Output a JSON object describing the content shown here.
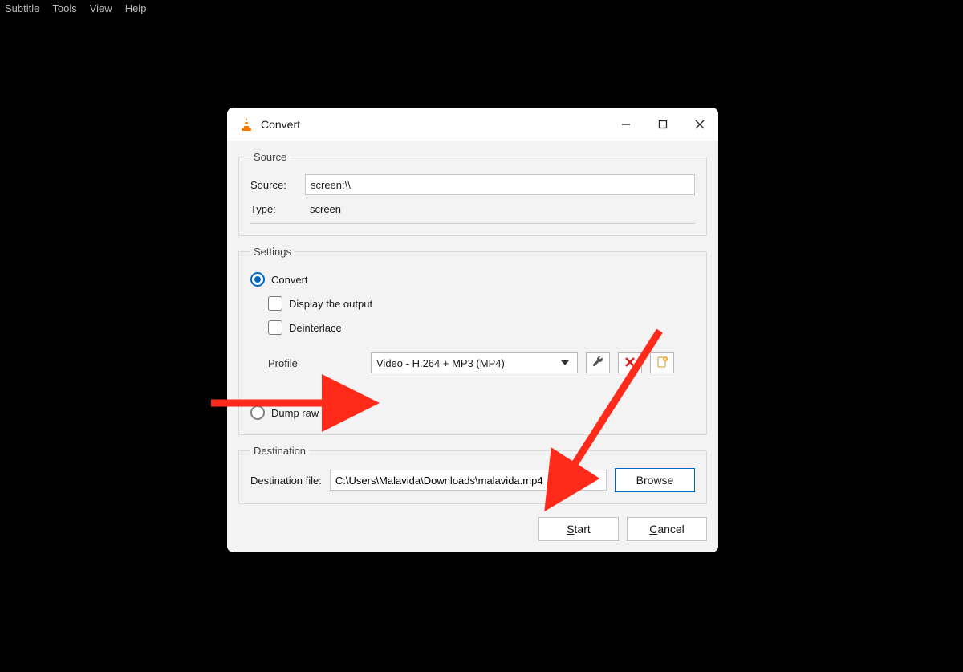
{
  "menubar": {
    "items": [
      "Subtitle",
      "Tools",
      "View",
      "Help"
    ]
  },
  "dialog": {
    "title": "Convert",
    "source_group": {
      "legend": "Source",
      "source_label": "Source:",
      "source_value": "screen:\\\\",
      "type_label": "Type:",
      "type_value": "screen"
    },
    "settings_group": {
      "legend": "Settings",
      "convert_label": "Convert",
      "display_output_label": "Display the output",
      "deinterlace_label": "Deinterlace",
      "profile_label": "Profile",
      "profile_value": "Video - H.264 + MP3 (MP4)",
      "dump_raw_label": "Dump raw input"
    },
    "destination_group": {
      "legend": "Destination",
      "dest_file_label": "Destination file:",
      "dest_file_value": "C:\\Users\\Malavida\\Downloads\\malavida.mp4",
      "browse_label": "Browse"
    },
    "footer": {
      "start_label": "Start",
      "cancel_label": "Cancel"
    }
  },
  "icons": {
    "wrench": "wrench-icon",
    "delete": "delete-profile-icon",
    "new": "new-profile-icon"
  }
}
